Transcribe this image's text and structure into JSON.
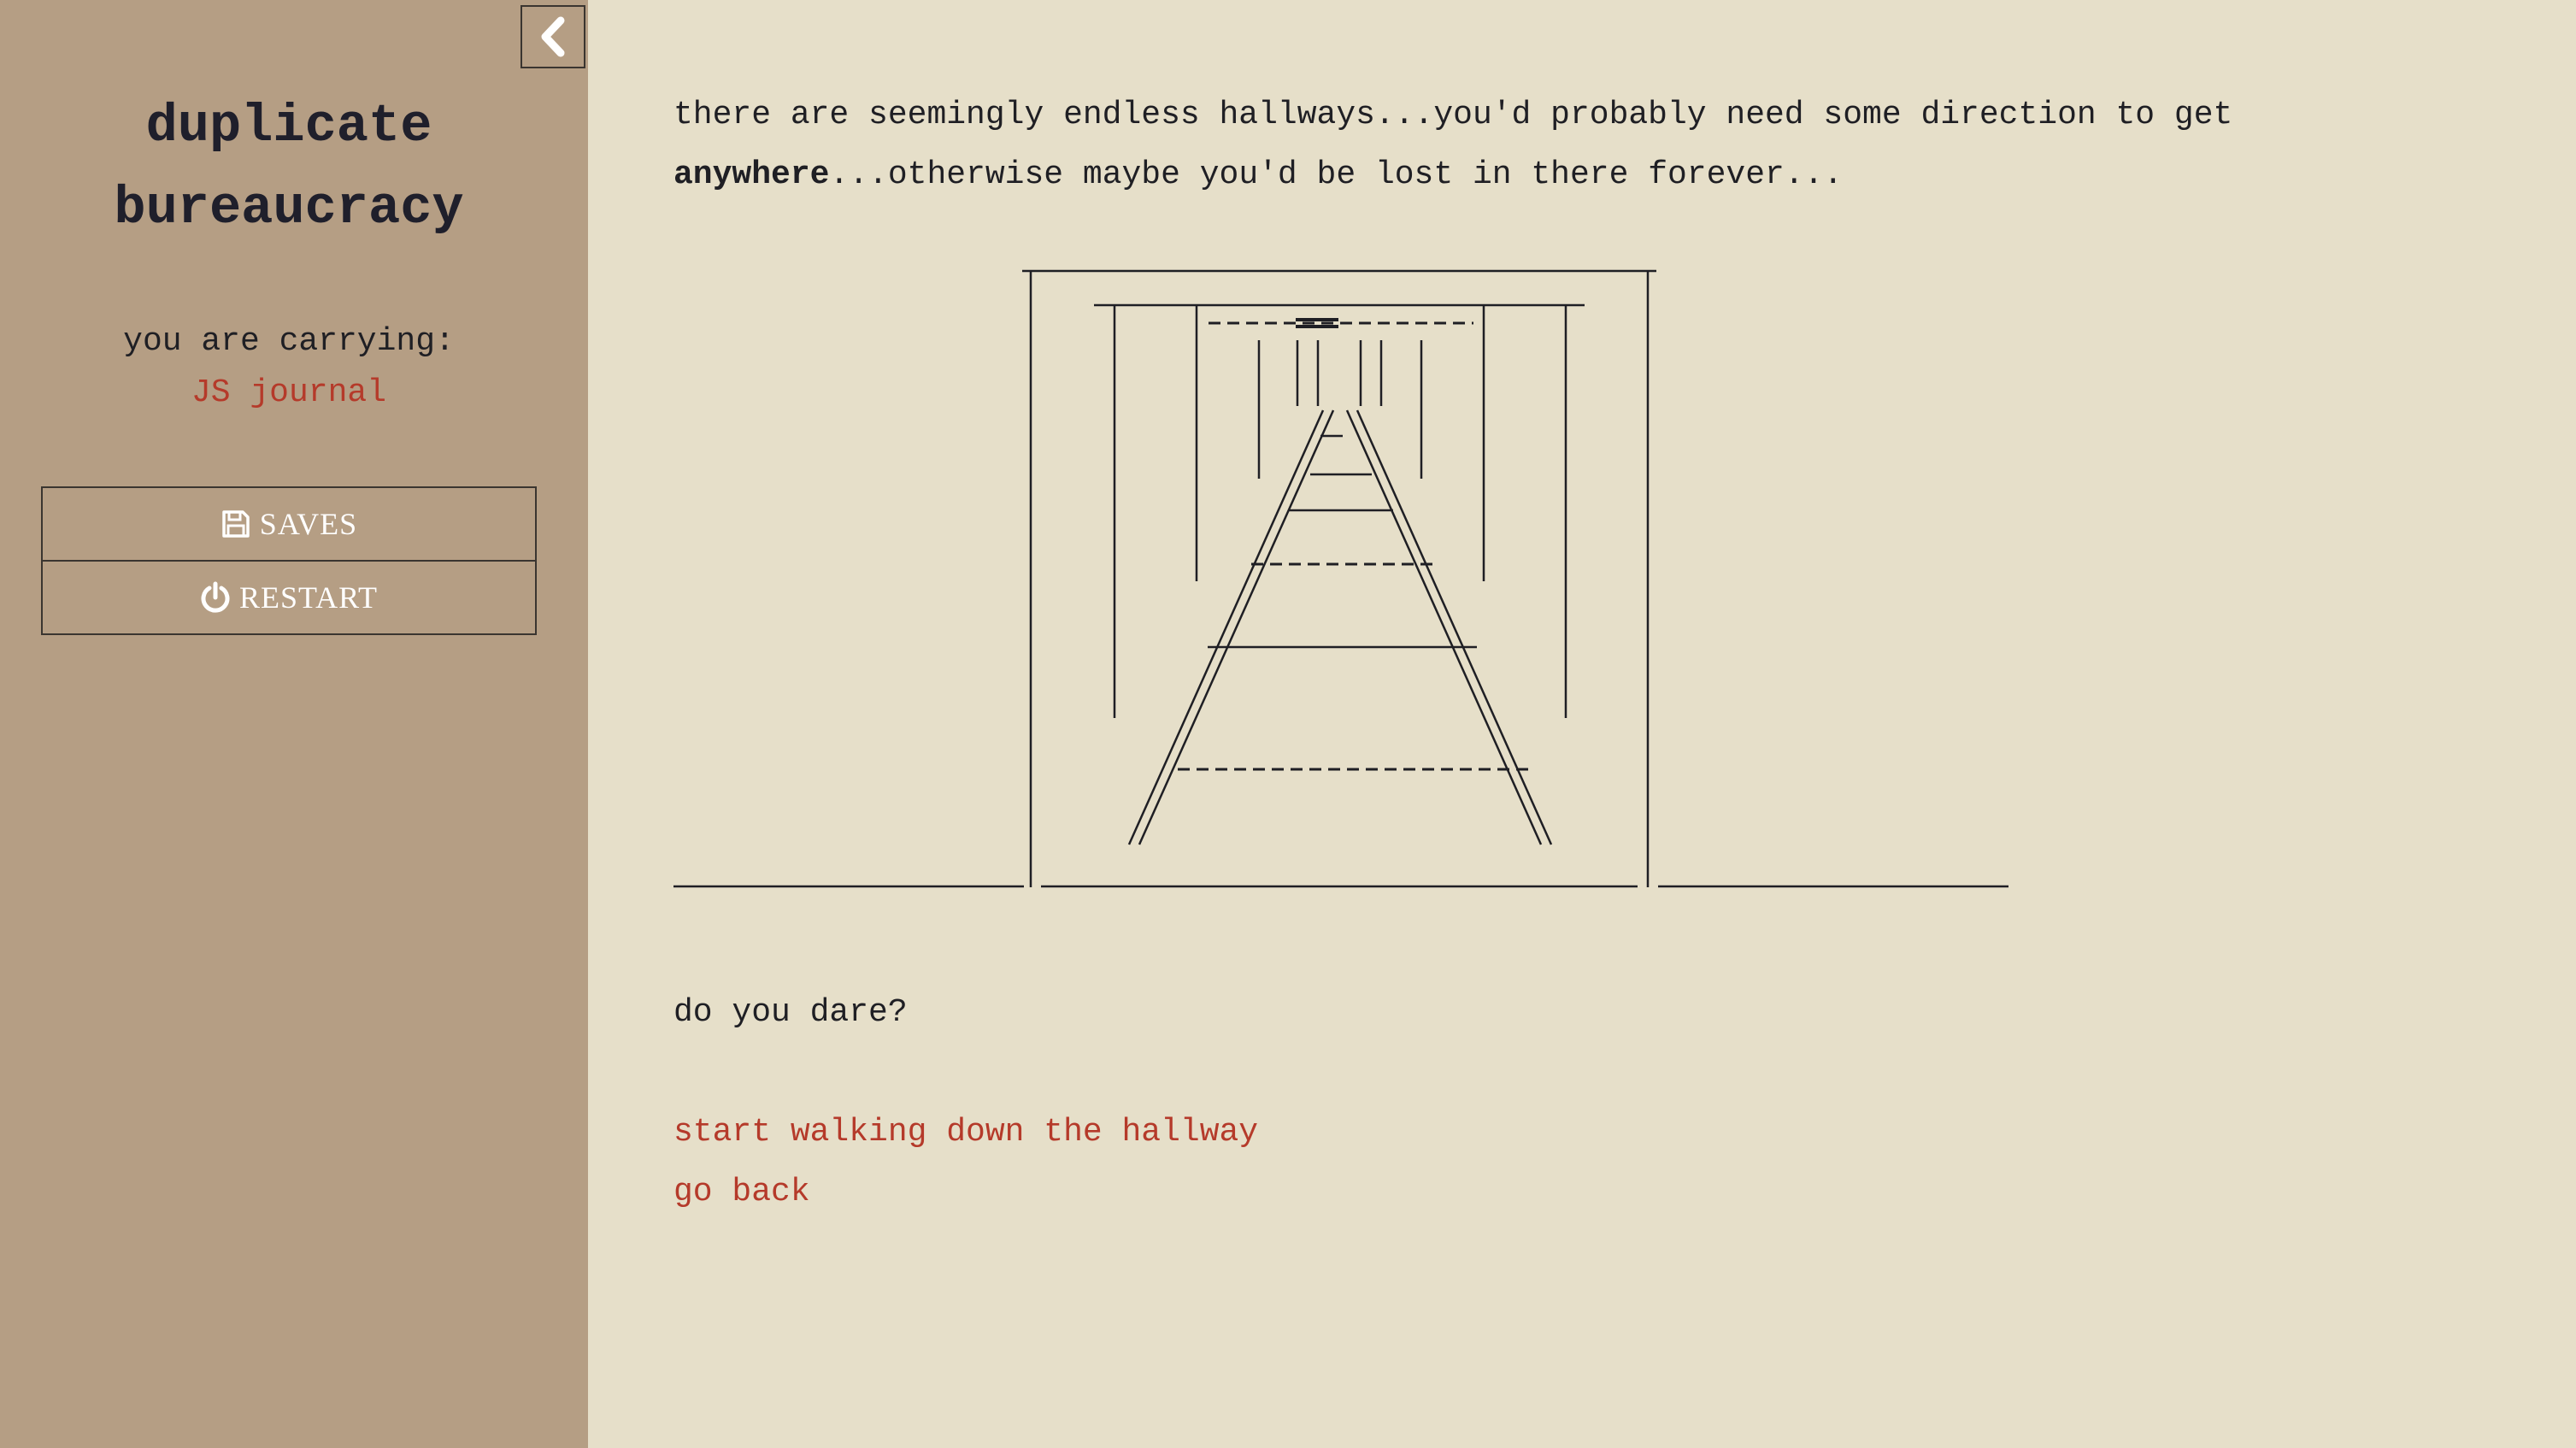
{
  "sidebar": {
    "title_line1": "duplicate",
    "title_line2": "bureaucracy",
    "carrying_label": "you are carrying:",
    "carrying_item": "JS journal",
    "saves_label": "SAVES",
    "restart_label": "RESTART",
    "toggle_icon": "chevron-left-icon",
    "saves_icon": "floppy-disk-icon",
    "restart_icon": "power-icon"
  },
  "passage": {
    "intro_part1": "there are seemingly endless hallways...you'd probably need some direction to get",
    "intro_bold": "anywhere",
    "intro_part2": "...otherwise maybe you'd be lost in there forever...",
    "question": "do you dare?"
  },
  "choices": [
    {
      "label": "start walking down the hallway"
    },
    {
      "label": "go back"
    }
  ],
  "colors": {
    "sidebar_bg": "#b59e84",
    "main_bg": "#e6dfc9",
    "link": "#b53a2a",
    "text": "#1f1f24"
  }
}
